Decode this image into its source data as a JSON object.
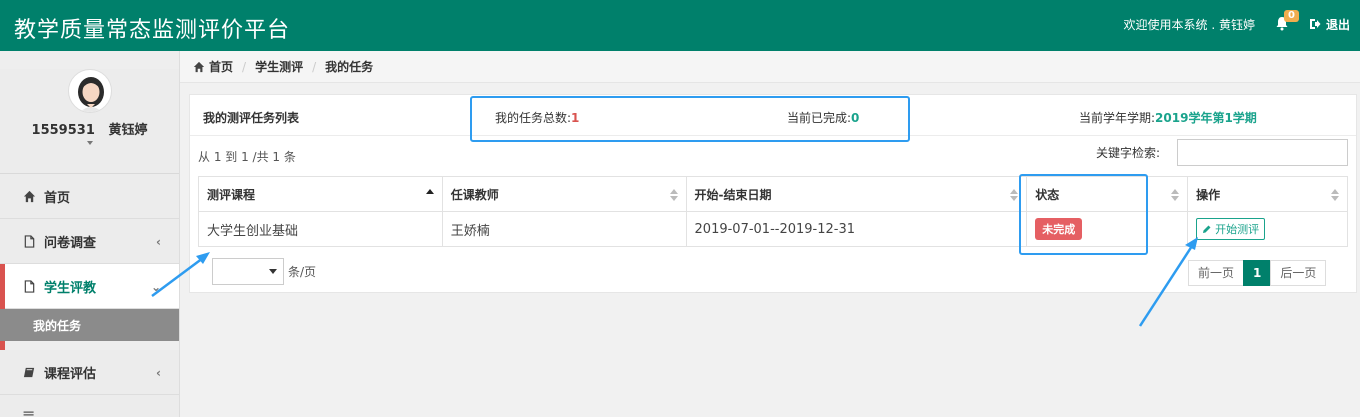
{
  "header": {
    "brand": "教学质量常态监测评价平台",
    "welcome": "欢迎使用本系统 . 黄钰婷",
    "notification_count": "0",
    "logout_label": "退出"
  },
  "sidebar": {
    "user_label": "1559531   黄钰婷",
    "items": [
      {
        "label": "首页",
        "icon": "home-icon"
      },
      {
        "label": "问卷调查",
        "icon": "file-icon"
      },
      {
        "label": "学生评教",
        "icon": "file-icon"
      },
      {
        "label": "课程评估",
        "icon": "book-icon"
      }
    ],
    "sub_item_label": "我的任务"
  },
  "breadcrumb": [
    "首页",
    "学生测评",
    "我的任务"
  ],
  "panel": {
    "title": "我的测评任务列表",
    "total_label": "我的任务总数:",
    "total_value": "1",
    "done_label": "当前已完成:",
    "done_value": "0",
    "term_label": "当前学年学期:",
    "term_value": "2019学年第1学期"
  },
  "table": {
    "info": "从 1 到 1 /共 1 条",
    "search_label": "关键字检索:",
    "search_value": "",
    "headers": [
      "测评课程",
      "任课教师",
      "开始-结束日期",
      "状态",
      "操作"
    ],
    "rows": [
      {
        "course": "大学生创业基础",
        "teacher": "王娇楠",
        "dates": "2019-07-01--2019-12-31",
        "status": "未完成",
        "action": "开始测评"
      }
    ],
    "page_size_label": "条/页",
    "pager": {
      "prev": "前一页",
      "current": "1",
      "next": "后一页"
    }
  },
  "colors": {
    "brand": "#00806b",
    "accent_red": "#d9534f",
    "highlight_blue": "#2e9cf0"
  }
}
